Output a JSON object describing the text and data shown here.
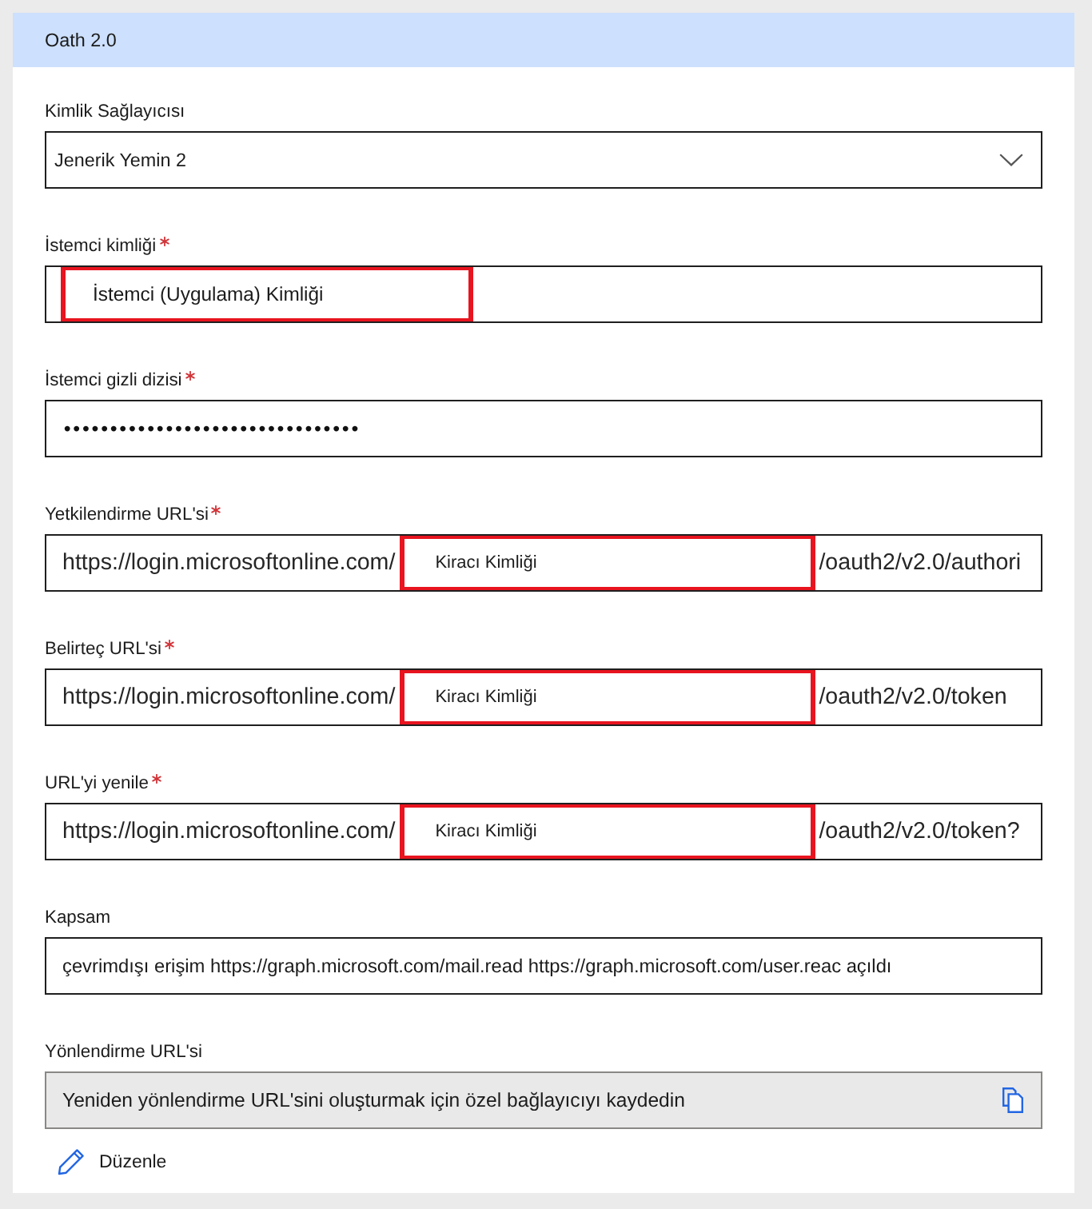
{
  "panel": {
    "title": "Oath 2.0"
  },
  "fields": [
    {
      "kind": "dropdown",
      "label": "Kimlik Sağlayıcısı",
      "required": false,
      "value": "Jenerik Yemin 2"
    },
    {
      "kind": "text",
      "label": "İstemci kimliği",
      "required": true,
      "value": "İstemci (Uygulama) Kimliği",
      "highlighted": true
    },
    {
      "kind": "password",
      "label": "İstemci gizli dizisi",
      "required": true,
      "value": "••••••••••••••••••••••••••••••••"
    },
    {
      "kind": "url",
      "label": "Yetkilendirme URL'si",
      "required": true,
      "prefix": "https://login.microsoftonline.com/",
      "tenant": "Kiracı Kimliği",
      "suffix": "/oauth2/v2.0/authori"
    },
    {
      "kind": "url",
      "label": "Belirteç URL'si",
      "required": true,
      "prefix": "https://login.microsoftonline.com/",
      "tenant": "Kiracı Kimliği",
      "suffix": "/oauth2/v2.0/token"
    },
    {
      "kind": "url",
      "label": "URL'yi yenile",
      "required": true,
      "prefix": "https://login.microsoftonline.com/",
      "tenant": "Kiracı Kimliği",
      "suffix": "/oauth2/v2.0/token?"
    },
    {
      "kind": "text",
      "label": "Kapsam",
      "required": false,
      "value": "çevrimdışı erişim https://graph.microsoft.com/mail.read https://graph.microsoft.com/user.reac açıldı",
      "highlighted": false
    },
    {
      "kind": "readonly",
      "label": "Yönlendirme URL'si",
      "required": false,
      "value": "Yeniden yönlendirme URL'sini oluşturmak için özel bağlayıcıyı kaydedin"
    }
  ],
  "edit_link": {
    "label": "Düzenle"
  }
}
